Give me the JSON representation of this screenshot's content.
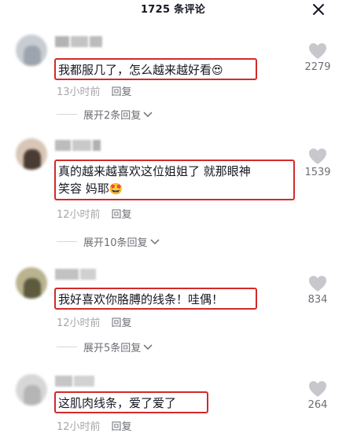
{
  "header": {
    "title": "1725 条评论",
    "close_icon": "close-icon"
  },
  "comments": [
    {
      "text": "我都服几了，怎么越来越好看",
      "emoji": "😍",
      "time": "13小时前",
      "reply_label": "回复",
      "expand_label": "展开2条回复",
      "likes": "2279"
    },
    {
      "text": "真的越来越喜欢这位姐姐了 就那眼神\n笑容 妈耶",
      "emoji": "🤩",
      "time": "12小时前",
      "reply_label": "回复",
      "expand_label": "展开10条回复",
      "likes": "1539"
    },
    {
      "text": "我好喜欢你胳膊的线条！哇偶！",
      "emoji": "",
      "time": "12小时前",
      "reply_label": "回复",
      "expand_label": "展开5条回复",
      "likes": "834"
    },
    {
      "text": "这肌肉线条，爱了爱了",
      "emoji": "",
      "time": "12小时前",
      "reply_label": "回复",
      "expand_label": "",
      "likes": "264"
    }
  ],
  "colors": {
    "highlight_border": "#d32a2a",
    "muted_text": "#a6a7ab",
    "secondary_text": "#6c6e74"
  }
}
